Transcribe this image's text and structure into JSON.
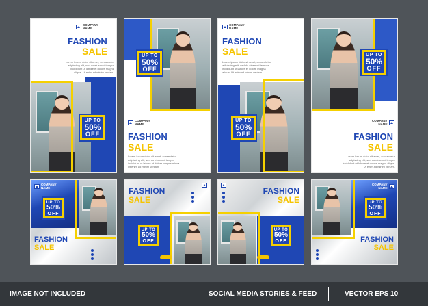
{
  "brand": {
    "company_line1": "COMPANY",
    "company_line2": "NAME"
  },
  "title": {
    "line1": "FASHION",
    "line2": "SALE"
  },
  "badge": {
    "line1": "UP TO",
    "line2": "50%",
    "line3": "OFF"
  },
  "lorem": "Lorem ipsum dolor sit amet, consectetur adipiscing elit, sed do eiusmod tempor incididunt ut labore et dolore magna aliqua. Ut enim ad minim veniam.",
  "footer": {
    "left": "IMAGE NOT INCLUDED",
    "middle": "SOCIAL MEDIA STORIES & FEED",
    "right": "VECTOR EPS 10"
  },
  "colors": {
    "primary": "#1f47b4",
    "accent": "#f5c400",
    "bg": "#4f5459",
    "footer": "#33373b"
  }
}
